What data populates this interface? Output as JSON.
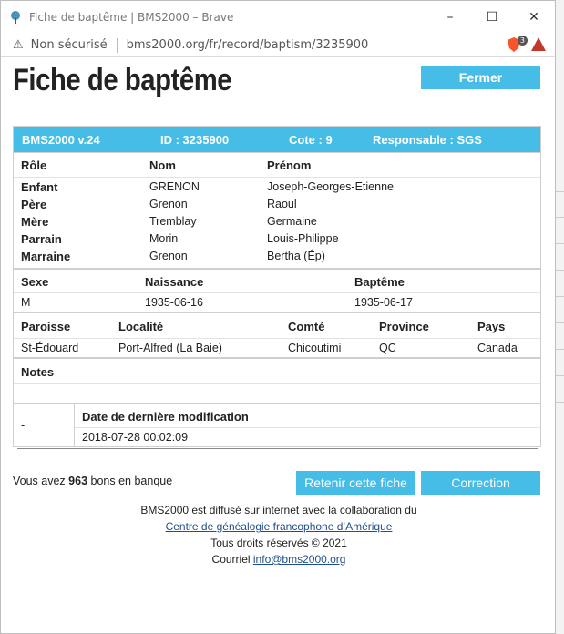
{
  "browser": {
    "window_title": "Fiche de baptême | BMS2000 – Brave",
    "minimize": "–",
    "maximize": "☐",
    "close": "✕",
    "security_label": "Non sécurisé",
    "url": "bms2000.org/fr/record/baptism/3235900",
    "shield_badge": "3"
  },
  "page": {
    "title": "Fiche de baptême",
    "close_button": "Fermer"
  },
  "record": {
    "header": {
      "version": "BMS2000 v.24",
      "id": "ID : 3235900",
      "cote": "Cote : 9",
      "responsable": "Responsable : SGS"
    },
    "people_headers": [
      "Rôle",
      "Nom",
      "Prénom"
    ],
    "people": [
      {
        "role": "Enfant",
        "nom": "GRENON",
        "prenom": "Joseph-Georges-Etienne"
      },
      {
        "role": "Père",
        "nom": "Grenon",
        "prenom": "Raoul"
      },
      {
        "role": "Mère",
        "nom": "Tremblay",
        "prenom": "Germaine"
      },
      {
        "role": "Parrain",
        "nom": "Morin",
        "prenom": "Louis-Philippe"
      },
      {
        "role": "Marraine",
        "nom": "Grenon",
        "prenom": "Bertha (Ép)"
      }
    ],
    "vital_headers": {
      "sexe": "Sexe",
      "naissance": "Naissance",
      "bapteme": "Baptême"
    },
    "vital": {
      "sexe": "M",
      "naissance": "1935-06-16",
      "bapteme": "1935-06-17"
    },
    "place_headers": {
      "paroisse": "Paroisse",
      "localite": "Localité",
      "comte": "Comté",
      "province": "Province",
      "pays": "Pays"
    },
    "place": {
      "paroisse": "St-Édouard",
      "localite": "Port-Alfred (La Baie)",
      "comte": "Chicoutimi",
      "province": "QC",
      "pays": "Canada"
    },
    "notes_header": "Notes",
    "notes_value": "-",
    "mod_left": "-",
    "mod_header": "Date de dernière modification",
    "mod_value": "2018-07-28 00:02:09"
  },
  "bank": {
    "prefix": "Vous avez",
    "count": "963",
    "suffix": "bons en banque"
  },
  "actions": {
    "retain": "Retenir cette fiche",
    "correction": "Correction"
  },
  "footer": {
    "line1": "BMS2000 est diffusé sur internet avec la collaboration du",
    "link1": "Centre de généalogie francophone d’Amérique",
    "line3": "Tous droits réservés © 2021",
    "line4_prefix": "Courriel",
    "email": "info@bms2000.org"
  },
  "colors": {
    "accent": "#45bde6"
  }
}
